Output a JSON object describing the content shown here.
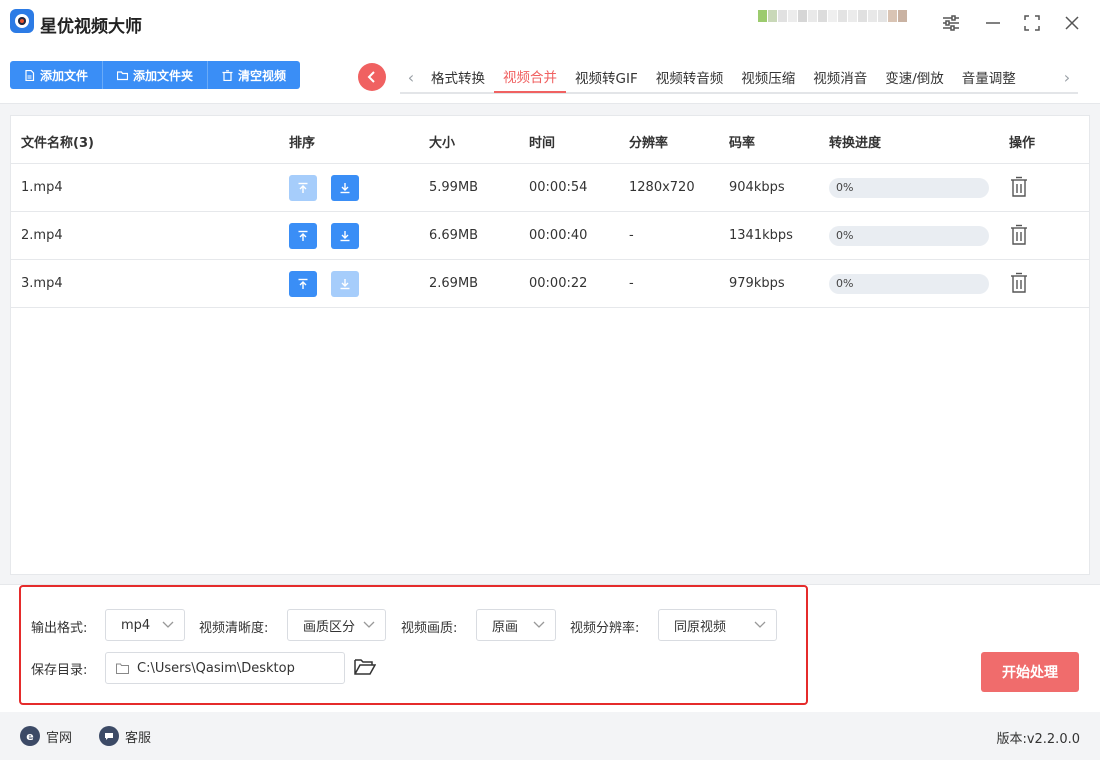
{
  "app": {
    "title": "星优视频大师",
    "accent": "#3a8ef6",
    "highlight": "#f06161"
  },
  "toolbar": {
    "add_file": "添加文件",
    "add_folder": "添加文件夹",
    "clear_videos": "清空视频"
  },
  "tabs": [
    {
      "label": "格式转换",
      "active": false
    },
    {
      "label": "视频合并",
      "active": true
    },
    {
      "label": "视频转GIF",
      "active": false
    },
    {
      "label": "视频转音频",
      "active": false
    },
    {
      "label": "视频压缩",
      "active": false
    },
    {
      "label": "视频消音",
      "active": false
    },
    {
      "label": "变速/倒放",
      "active": false
    },
    {
      "label": "音量调整",
      "active": false
    }
  ],
  "table": {
    "headers": {
      "name": "文件名称(3)",
      "order": "排序",
      "size": "大小",
      "time": "时间",
      "resolution": "分辨率",
      "bitrate": "码率",
      "progress": "转换进度",
      "action": "操作"
    },
    "rows": [
      {
        "name": "1.mp4",
        "size": "5.99MB",
        "time": "00:00:54",
        "resolution": "1280x720",
        "bitrate": "904kbps",
        "progress_text": "0%",
        "progress": 0,
        "up_enabled": false,
        "down_enabled": true
      },
      {
        "name": "2.mp4",
        "size": "6.69MB",
        "time": "00:00:40",
        "resolution": "-",
        "bitrate": "1341kbps",
        "progress_text": "0%",
        "progress": 0,
        "up_enabled": true,
        "down_enabled": true
      },
      {
        "name": "3.mp4",
        "size": "2.69MB",
        "time": "00:00:22",
        "resolution": "-",
        "bitrate": "979kbps",
        "progress_text": "0%",
        "progress": 0,
        "up_enabled": true,
        "down_enabled": false
      }
    ]
  },
  "settings": {
    "output_format_label": "输出格式:",
    "output_format_value": "mp4",
    "clarity_label": "视频清晰度:",
    "clarity_value": "画质区分",
    "quality_label": "视频画质:",
    "quality_value": "原画",
    "resolution_label": "视频分辨率:",
    "resolution_value": "同原视频",
    "save_dir_label": "保存目录:",
    "save_dir_value": "C:\\Users\\Qasim\\Desktop",
    "start_button": "开始处理"
  },
  "footer": {
    "website": "官网",
    "service": "客服",
    "version": "版本:v2.2.0.0"
  }
}
